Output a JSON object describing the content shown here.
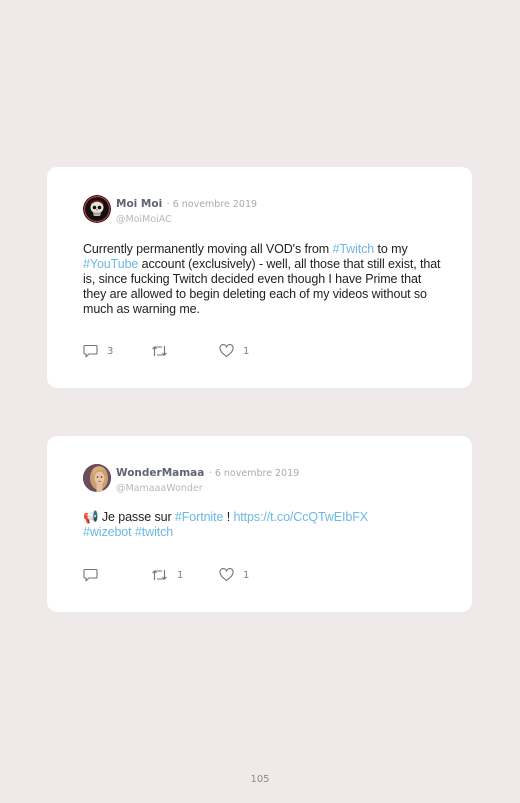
{
  "page": {
    "number": "105",
    "background": "#efe9e9"
  },
  "colors": {
    "hashtag": "#6bb8e4",
    "name": "#5e6470",
    "meta": "#a6abb3"
  },
  "tweets": [
    {
      "author": "Moi Moi",
      "date": "· 6 novembre 2019",
      "handle": "@MoiMoiAC",
      "avatar_icon": "skull-avatar",
      "text": {
        "t1": "Currently permanently moving all VOD's from ",
        "h1": "#Twitch",
        "t2": " to my ",
        "h2": "#YouTube",
        "t3": " account (exclusively) - well, all those that still exist, that is, since fucking Twitch decided even though I have Prime that they are allowed to begin deleting each of my videos without so much as warning me."
      },
      "replies": "3",
      "retweets": "",
      "likes": "1"
    },
    {
      "author": "WonderMamaa",
      "date": "· 6 novembre 2019",
      "handle": "@MamaaaWonder",
      "avatar_icon": "portrait-avatar",
      "text": {
        "emoji": "📢",
        "t1": " Je passe sur ",
        "h1": "#Fortnite",
        "t2": " ! ",
        "h2": "https://t.co/CcQTwEIbFX",
        "h3": "#wizebot",
        "h4": "#twitch"
      },
      "replies": "",
      "retweets": "1",
      "likes": "1"
    }
  ]
}
